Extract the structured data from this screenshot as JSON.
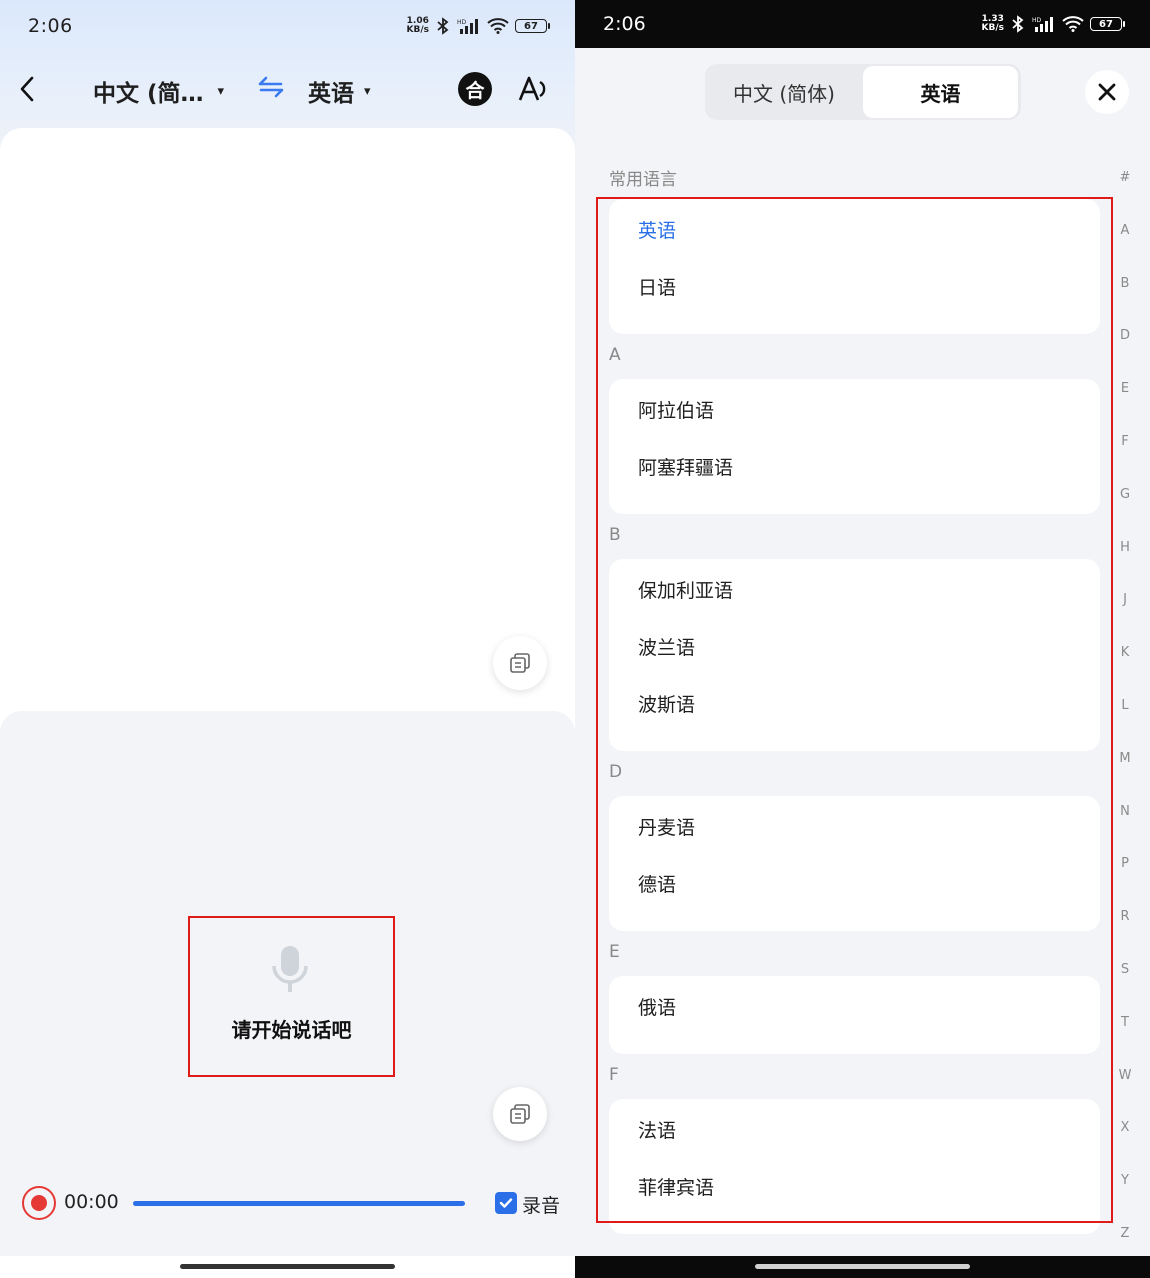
{
  "left": {
    "status": {
      "time": "2:06",
      "speed_top": "1.06",
      "speed_bottom": "KB/s",
      "battery": "67"
    },
    "toolbar": {
      "source_lang": "中文 (简…",
      "target_lang": "英语",
      "he_label": "合",
      "caret": "▾"
    },
    "prompt": "请开始说话吧",
    "recorder": {
      "time": "00:00",
      "record_label": "录音",
      "record_checked": true
    }
  },
  "right": {
    "status": {
      "time": "2:06",
      "speed_top": "1.33",
      "speed_bottom": "KB/s",
      "battery": "67"
    },
    "segment": {
      "source": "中文 (简体)",
      "target": "英语",
      "selected": "target"
    },
    "sections": [
      {
        "title": "常用语言",
        "items": [
          "英语",
          "日语"
        ],
        "active": "英语"
      },
      {
        "title": "A",
        "items": [
          "阿拉伯语",
          "阿塞拜疆语"
        ]
      },
      {
        "title": "B",
        "items": [
          "保加利亚语",
          "波兰语",
          "波斯语"
        ]
      },
      {
        "title": "D",
        "items": [
          "丹麦语",
          "德语"
        ]
      },
      {
        "title": "E",
        "items": [
          "俄语"
        ]
      },
      {
        "title": "F",
        "items": [
          "法语",
          "菲律宾语"
        ]
      }
    ],
    "index_letters": [
      "#",
      "A",
      "B",
      "D",
      "E",
      "F",
      "G",
      "H",
      "J",
      "K",
      "L",
      "M",
      "N",
      "P",
      "R",
      "S",
      "T",
      "W",
      "X",
      "Y",
      "Z"
    ]
  },
  "colors": {
    "accent": "#2a6fe8",
    "record": "#e53935",
    "highlight": "#e01919"
  }
}
